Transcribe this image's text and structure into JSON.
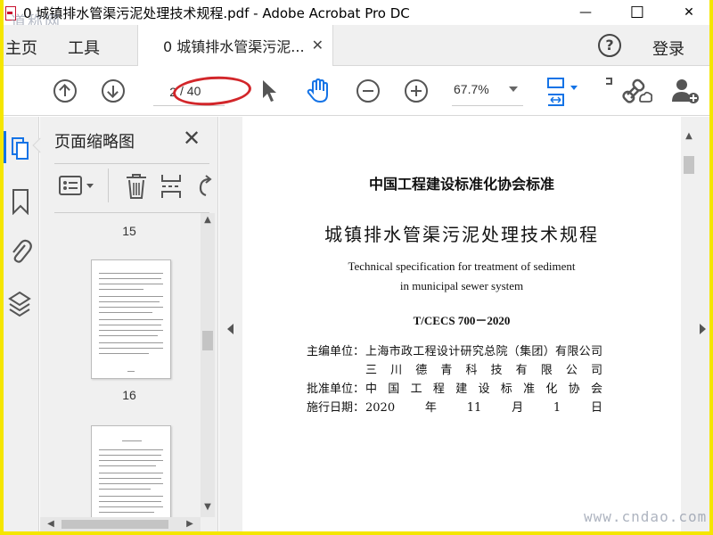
{
  "window": {
    "title": "0 城镇排水管渠污泥处理技术规程.pdf - Adobe Acrobat Pro DC",
    "minimize_glyph": "—",
    "maximize_glyph": "☐",
    "close_glyph": "✕"
  },
  "watermarks": {
    "top": "道称网",
    "bottom": "www.cndao.com"
  },
  "tabs": {
    "home": "主页",
    "tools": "工具",
    "document_tab": "0 城镇排水管渠污泥...",
    "close_glyph": "✕",
    "help_glyph": "?",
    "login": "登录"
  },
  "toolbar": {
    "current_page": "2",
    "total_pages": "/ 40",
    "zoom": "67.7%"
  },
  "thumbnails": {
    "title": "页面缩略图",
    "close_glyph": "✕",
    "pages": [
      {
        "label": "15"
      },
      {
        "label": "16"
      }
    ]
  },
  "document": {
    "org_standard": "中国工程建设标准化协会标准",
    "title_cn": "城镇排水管渠污泥处理技术规程",
    "title_en_line1": "Technical specification for treatment of sediment",
    "title_en_line2": "in municipal sewer system",
    "code": "T/CECS 700－2020",
    "meta": [
      {
        "label": "主编单位：",
        "value": "上海市政工程设计研究总院（集团）有限公司"
      },
      {
        "label": "",
        "value": "三川德青科技有限公司"
      },
      {
        "label": "批准单位：",
        "value": "中国工程建设标准化协会"
      },
      {
        "label": "施行日期：",
        "value": "2020年11月1日"
      }
    ]
  },
  "colors": {
    "accent": "#1473e6",
    "annotation_red": "#d2262a",
    "border_yellow": "#f5e600"
  }
}
